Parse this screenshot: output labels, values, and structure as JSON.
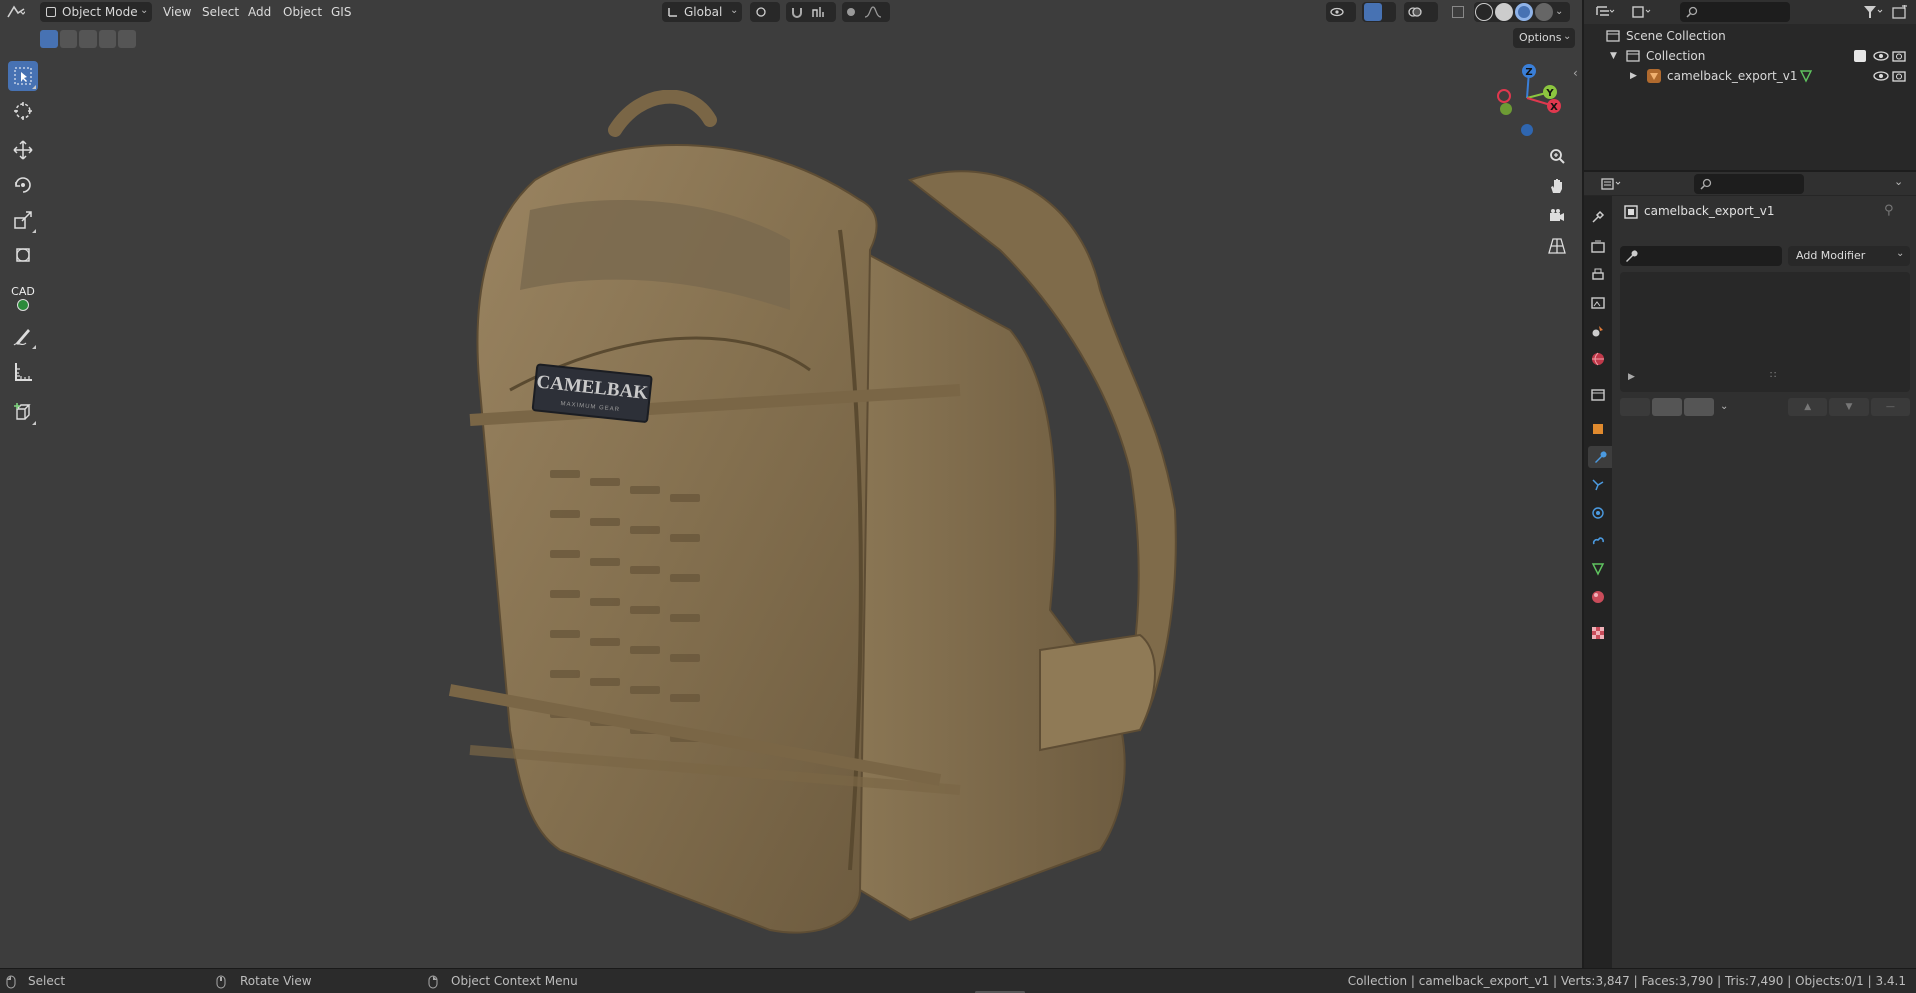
{
  "header": {
    "mode_label": "Object Mode",
    "menus": [
      "View",
      "Select",
      "Add",
      "Object",
      "GIS"
    ],
    "transform_orientation": "Global",
    "options_label": "Options"
  },
  "toolbar": {
    "cad_label": "CAD"
  },
  "viewport": {
    "object_label_line1": "CAMELBAK",
    "object_label_line2": "MAXIMUM GEAR",
    "gizmo_axes": {
      "x": "X",
      "y": "Y",
      "z": "Z"
    }
  },
  "outliner": {
    "scene_collection": "Scene Collection",
    "collection": "Collection",
    "object": "camelback_export_v1"
  },
  "properties": {
    "object_name": "camelback_export_v1",
    "add_modifier": "Add Modifier"
  },
  "statusbar": {
    "select": "Select",
    "rotate_view": "Rotate View",
    "context_menu": "Object Context Menu",
    "stats": "Collection | camelback_export_v1 | Verts:3,847 | Faces:3,790 | Tris:7,490 | Objects:0/1 | 3.4.1"
  },
  "colors": {
    "accent": "#4772b3",
    "bag": "#8a7350",
    "axis_x": "#e0384e",
    "axis_y": "#8cc63f",
    "axis_z": "#3a7fd8"
  }
}
